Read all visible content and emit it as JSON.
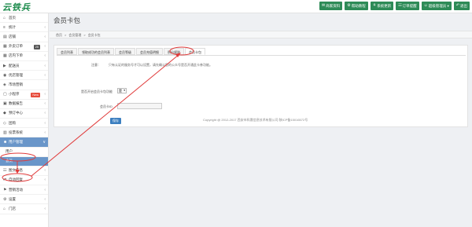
{
  "app": {
    "logo_text": "云铁兵"
  },
  "topbar": {
    "buttons": [
      {
        "icon": "✉",
        "label": "商家资料"
      },
      {
        "icon": "⚙",
        "label": "帮助教程"
      },
      {
        "icon": "⚘",
        "label": "系统更新"
      },
      {
        "icon": "☷",
        "label": "订单提醒"
      },
      {
        "icon": "☺",
        "label": "超级管理员 ▾"
      },
      {
        "icon": "↶",
        "label": "退出"
      }
    ]
  },
  "sidebar": {
    "items": [
      {
        "icon": "⌂",
        "label": "首页",
        "arrow": ""
      },
      {
        "icon": "≡",
        "label": "统计",
        "arrow": "‹"
      },
      {
        "icon": "▤",
        "label": "店铺",
        "arrow": "‹"
      },
      {
        "icon": "▦",
        "label": "外卖订单",
        "arrow": "‹",
        "badge": "25",
        "badge_style": "dark"
      },
      {
        "icon": "▦",
        "label": "店内下单",
        "arrow": "‹"
      },
      {
        "icon": "▶",
        "label": "配送员",
        "arrow": "‹"
      },
      {
        "icon": "◉",
        "label": "优店管理",
        "arrow": "‹"
      },
      {
        "icon": "◈",
        "label": "市场营销",
        "arrow": ""
      },
      {
        "icon": "▢",
        "label": "小程序",
        "arrow": "‹",
        "badge": "New",
        "badge_style": "red"
      },
      {
        "icon": "▣",
        "label": "数据报告",
        "arrow": "‹"
      },
      {
        "icon": "◆",
        "label": "预订中心",
        "arrow": "‹"
      },
      {
        "icon": "◇",
        "label": "团购",
        "arrow": "‹"
      },
      {
        "icon": "▥",
        "label": "投票系统",
        "arrow": "‹"
      },
      {
        "icon": "☻",
        "label": "用户管理",
        "arrow": "∨",
        "active": true
      }
    ],
    "sub_items": [
      {
        "label": "用户",
        "selected": false
      },
      {
        "label": "会员",
        "selected": true
      }
    ],
    "bottom_items": [
      {
        "icon": "☷",
        "label": "图文信息",
        "arrow": "‹"
      },
      {
        "icon": "⇄",
        "label": "自动回复",
        "arrow": "‹"
      },
      {
        "icon": "⚑",
        "label": "营销活动",
        "arrow": "‹"
      },
      {
        "icon": "⚙",
        "label": "设置",
        "arrow": "‹"
      },
      {
        "icon": "⌂",
        "label": "门店",
        "arrow": "‹"
      }
    ]
  },
  "main": {
    "page_title": "会员卡包",
    "breadcrumb": [
      "首页",
      ">",
      "会员管理",
      ">",
      "会员卡包"
    ],
    "tabs": [
      {
        "label": "会员列表",
        "active": false
      },
      {
        "label": "领取成功的会员列表",
        "active": false
      },
      {
        "label": "会员等级",
        "active": false
      },
      {
        "label": "会员充值明细",
        "active": false
      },
      {
        "label": "积分规则",
        "active": false
      },
      {
        "label": "会员卡包",
        "active": true
      }
    ],
    "note_label": "注意：",
    "note_text": "只有认证的服务号才可以设置，请先确认您的公众号是否开通此卡券功能。",
    "enable_label": "是否开启会员卡包功能",
    "enable_value": "是",
    "card_id_label": "会员卡ID",
    "card_id_value": "",
    "save_label": "保存"
  },
  "footer": {
    "copyright": "Copyright @ 2012-2017 西安市科晟信息技术有限公司 陕ICP备15016572号"
  },
  "colors": {
    "topbar_button": "#2e8b57",
    "sidebar_active": "#6a96c9",
    "save_button": "#3c7fc0",
    "annotation": "#e03a3a"
  }
}
